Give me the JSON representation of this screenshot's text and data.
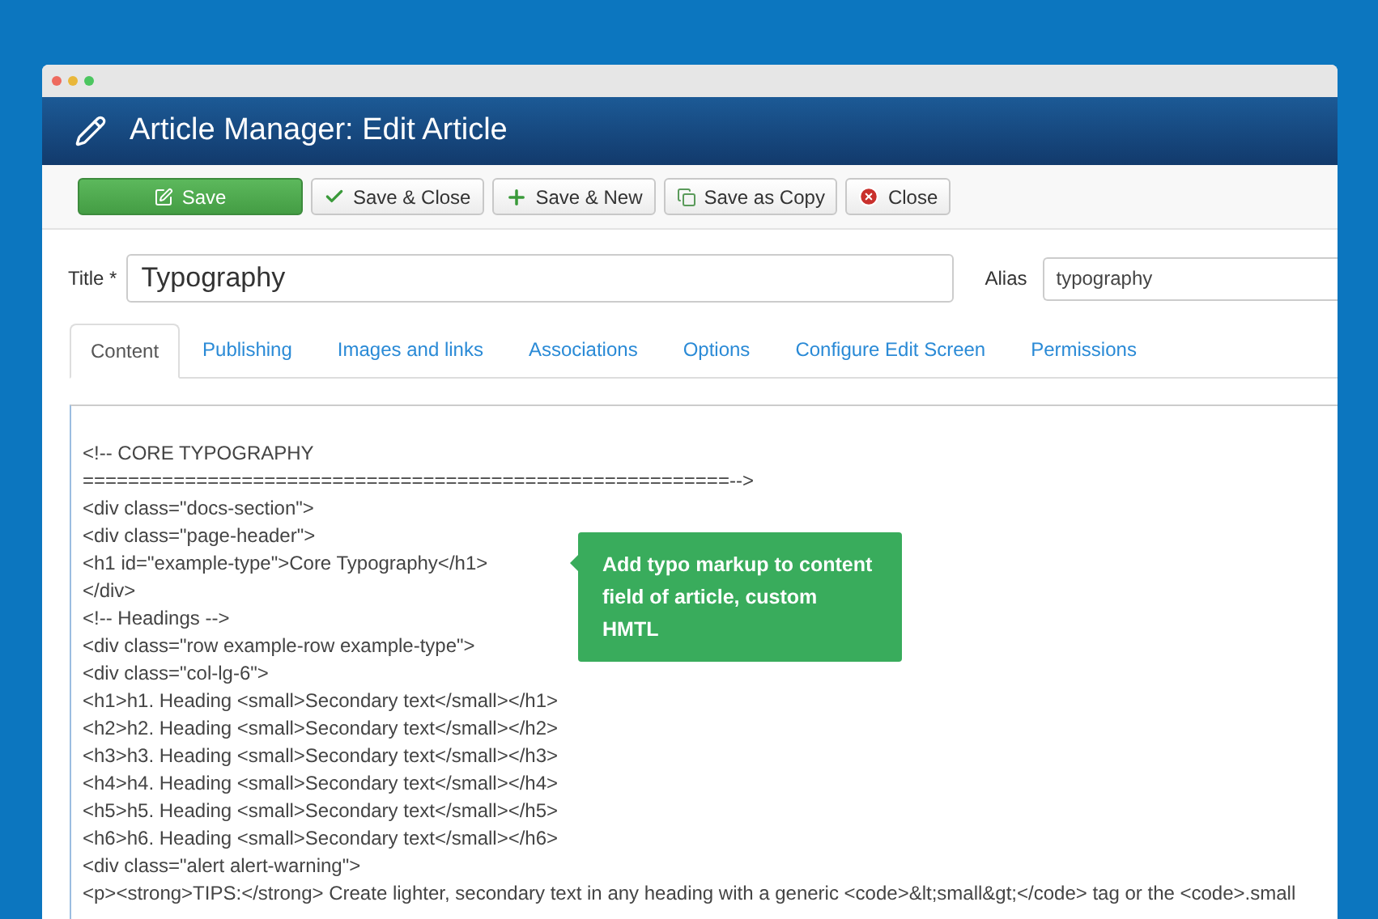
{
  "window": {
    "title": "Article Manager: Edit Article"
  },
  "toolbar": [
    {
      "label": "Save",
      "kind": "primary"
    },
    {
      "label": "Save & Close",
      "kind": "check"
    },
    {
      "label": "Save & New",
      "kind": "plus"
    },
    {
      "label": "Save as Copy",
      "kind": "copy"
    },
    {
      "label": "Close",
      "kind": "close"
    }
  ],
  "fields": {
    "title": {
      "label": "Title *",
      "value": "Typography"
    },
    "alias": {
      "label": "Alias",
      "value": "typography"
    }
  },
  "tabs": [
    {
      "label": "Content",
      "selected": true
    },
    {
      "label": "Publishing",
      "selected": false
    },
    {
      "label": "Images and links",
      "selected": false
    },
    {
      "label": "Associations",
      "selected": false
    },
    {
      "label": "Options",
      "selected": false
    },
    {
      "label": "Configure Edit Screen",
      "selected": false
    },
    {
      "label": "Permissions",
      "selected": false
    }
  ],
  "editor": {
    "lines": [
      "<!-- CORE TYPOGRAPHY",
      "=========================================================-->",
      "<div class=\"docs-section\">",
      "<div class=\"page-header\">",
      "<h1 id=\"example-type\">Core Typography</h1>",
      "</div>",
      "<!-- Headings -->",
      "<div class=\"row example-row example-type\">",
      "<div class=\"col-lg-6\">",
      "<h1>h1. Heading <small>Secondary text</small></h1>",
      "<h2>h2. Heading <small>Secondary text</small></h2>",
      "<h3>h3. Heading <small>Secondary text</small></h3>",
      "<h4>h4. Heading <small>Secondary text</small></h4>",
      "<h5>h5. Heading <small>Secondary text</small></h5>",
      "<h6>h6. Heading <small>Secondary text</small></h6>",
      "<div class=\"alert alert-warning\">",
      "<p><strong>TIPS:</strong> Create lighter, secondary text in any heading with a generic <code>&lt;small&gt;</code> tag or the <code>.small"
    ]
  },
  "tooltip": {
    "text": "Add typo markup to content field of article, custom HMTL"
  }
}
